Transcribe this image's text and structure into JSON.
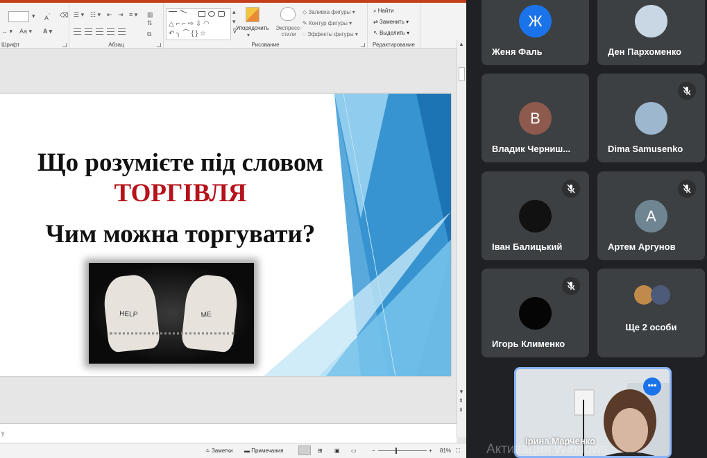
{
  "ribbon": {
    "groups": {
      "font": "Шрифт",
      "paragraph": "Абзац",
      "drawing": "Рисование",
      "editing": "Редактирование"
    },
    "arrange_label": "Упорядочить",
    "quick_styles_label": "Экспресс-стили",
    "shape_fill": "Заливка фигуры",
    "shape_outline": "Контур фигуры",
    "shape_effects": "Эффекты фигуры",
    "find": "Найти",
    "replace": "Заменить",
    "select": "Выделить",
    "font_size_letters": "Aa"
  },
  "slide": {
    "line1": "Що розумієте під словом",
    "line2": "ТОРГІВЛЯ",
    "line3": "Чим можна торгувати?",
    "image_hand_left": "HELP",
    "image_hand_right": "ME"
  },
  "notes": {
    "placeholder": "у"
  },
  "status": {
    "notes_btn": "Заметки",
    "comments_btn": "Примечания",
    "zoom": "81%",
    "zoom_minus": "−",
    "zoom_plus": "+"
  },
  "participants": [
    {
      "name": "Женя Фаль",
      "initial": "Ж",
      "avatar_color": "#1a73e8",
      "muted": false
    },
    {
      "name": "Ден Пархоменко",
      "initial": "",
      "avatar_color": "#c9d6e3",
      "muted": false
    },
    {
      "name": "Владик Черниш...",
      "initial": "В",
      "avatar_color": "#8d5a4d",
      "muted": false
    },
    {
      "name": "Dima Samusenko",
      "initial": "",
      "avatar_color": "#9db7cf",
      "muted": true
    },
    {
      "name": "Іван Балицький",
      "initial": "",
      "avatar_color": "#111111",
      "muted": true
    },
    {
      "name": "Артем Аргунов",
      "initial": "А",
      "avatar_color": "#6f8591",
      "muted": true
    },
    {
      "name": "Игорь Клименко",
      "initial": "",
      "avatar_color": "#050505",
      "muted": true
    },
    {
      "name": "Ще 2 особи",
      "initial": "",
      "avatar_color": "",
      "muted": false
    }
  ],
  "self_view": {
    "name": "Ірина Марченко",
    "more_label": "•••"
  },
  "watermark": "Активация Windows"
}
